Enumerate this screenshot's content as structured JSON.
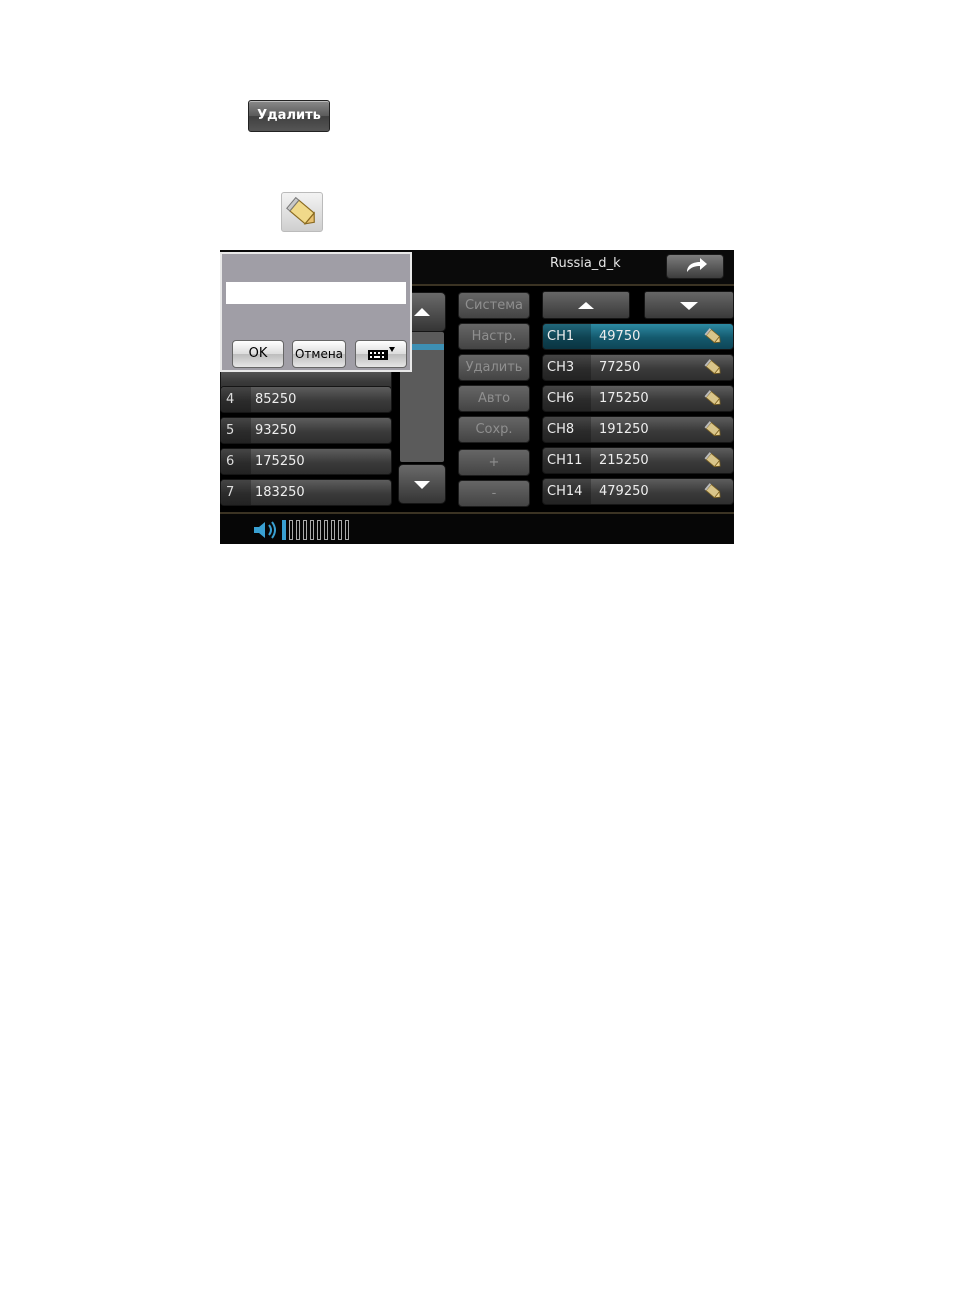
{
  "doc": {
    "delete_label": "Удалить"
  },
  "header": {
    "title": "Russia_d_k"
  },
  "list": [
    {
      "num": "4",
      "value": "85250"
    },
    {
      "num": "5",
      "value": "93250"
    },
    {
      "num": "6",
      "value": "175250"
    },
    {
      "num": "7",
      "value": "183250"
    }
  ],
  "side_buttons": [
    "Система",
    "Настр.",
    "Удалить",
    "Авто",
    "Сохр.",
    "+",
    "-"
  ],
  "channels": [
    {
      "ch": "CH1",
      "freq": "49750",
      "selected": true
    },
    {
      "ch": "CH3",
      "freq": "77250"
    },
    {
      "ch": "CH6",
      "freq": "175250"
    },
    {
      "ch": "CH8",
      "freq": "191250"
    },
    {
      "ch": "CH11",
      "freq": "215250"
    },
    {
      "ch": "CH14",
      "freq": "479250"
    }
  ],
  "dialog": {
    "input_value": "",
    "ok_label": "OK",
    "cancel_label": "Отмена"
  },
  "volume": {
    "level": 1,
    "max": 10
  },
  "colors": {
    "accent": "#2d8aa3",
    "volume": "#39a0d2"
  },
  "icons": [
    "edit-pencil-icon",
    "back-arrow-icon",
    "arrow-up-icon",
    "arrow-down-icon",
    "keyboard-icon",
    "speaker-icon"
  ]
}
